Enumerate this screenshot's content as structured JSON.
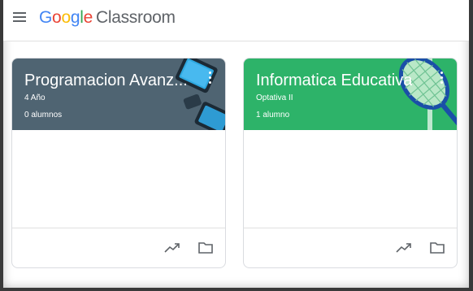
{
  "app": {
    "logo_letters": [
      "G",
      "o",
      "o",
      "g",
      "l",
      "e"
    ],
    "product": "Classroom",
    "menu_icon": "hamburger-menu-icon"
  },
  "courses": [
    {
      "title": "Programacion Avanz...",
      "section": "4 Año",
      "students": "0 alumnos",
      "color": "#4f6472",
      "icons": [
        "trending-up-icon",
        "folder-icon"
      ]
    },
    {
      "title": "Informatica Educativa",
      "section": "Optativa II",
      "students": "1 alumno",
      "color": "#2db369",
      "icons": [
        "trending-up-icon",
        "folder-icon"
      ]
    }
  ]
}
